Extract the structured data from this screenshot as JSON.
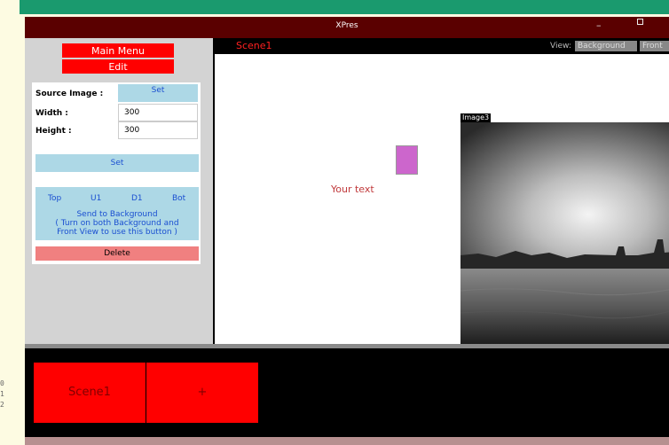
{
  "window": {
    "title": "XPres",
    "minimize_glyph": "–"
  },
  "left_panel": {
    "main_menu_label": "Main Menu",
    "edit_label": "Edit",
    "source_image_label": "Source Image :",
    "source_set_label": "Set",
    "width_label": "Width :",
    "width_value": "300",
    "height_label": "Height :",
    "height_value": "300",
    "set_label": "Set",
    "layer_buttons": [
      "Top",
      "U1",
      "D1",
      "Bot"
    ],
    "send_line1": "Send to Background",
    "send_line2": "( Turn on both Background and",
    "send_line3": "Front View to use this button )",
    "delete_label": "Delete"
  },
  "scene_bar": {
    "scene_name": "Scene1",
    "view_label": "View:",
    "view_background": "Background",
    "view_front": "Front"
  },
  "canvas": {
    "text_element": "Your text",
    "image_label": "Image3"
  },
  "scene_strip": {
    "scenes": [
      "Scene1"
    ],
    "add_label": "+"
  },
  "colors": {
    "title_bar": "#5a0000",
    "red_button": "#ff0000",
    "blue_button": "#add8e6",
    "delete_button": "#f08080",
    "shape_fill": "#cc66cc"
  }
}
